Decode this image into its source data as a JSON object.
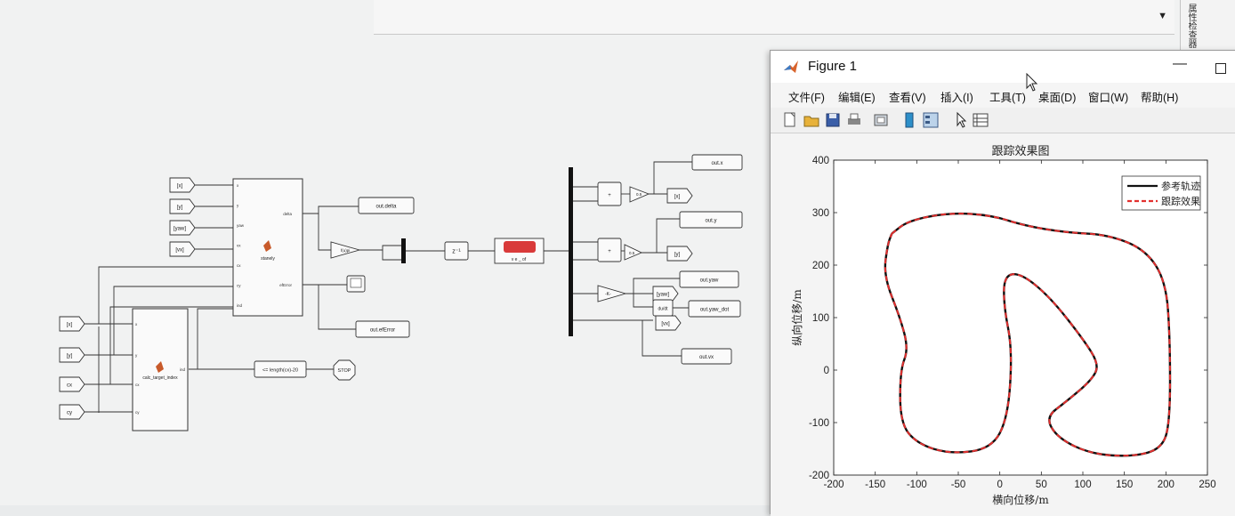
{
  "simulink": {
    "from_inputs_top": [
      "[x]",
      "[y]",
      "[yaw]",
      "[vx]"
    ],
    "from_inputs_bottom": [
      "[x]",
      "[y]",
      "cx",
      "cy"
    ],
    "stanley_block": {
      "name": "stanely",
      "ports_in": [
        "x",
        "y",
        "yaw",
        "vx",
        "cx",
        "cy",
        "ind"
      ],
      "ports_out": [
        "delta",
        "efError"
      ]
    },
    "calc_block": {
      "name": "calc_target_index",
      "ports_in": [
        "x",
        "y",
        "cx",
        "cy"
      ],
      "ports_out": [
        "ind"
      ]
    },
    "saturation_label": "f(u)pi",
    "delay_label": "z⁻¹",
    "vehicle_label": "v e _ of",
    "compare_label": "<= length(cx)-20",
    "stop_label": "STOP",
    "gain_labels": [
      "0.5",
      "0.5",
      "-K-"
    ],
    "goto_tags": [
      "[x]",
      "[y]",
      "[yaw]",
      "[vx]"
    ],
    "integrator_labels": [
      "du/dt"
    ],
    "workspace_outputs": [
      "out.delta",
      "out.efError",
      "out.x",
      "out.y",
      "out.yaw",
      "out.yaw_dot",
      "out.vx"
    ]
  },
  "side_panel": {
    "label": "属性检查器"
  },
  "figure": {
    "title": "Figure 1",
    "menus": [
      "文件(F)",
      "编辑(E)",
      "查看(V)",
      "插入(I)",
      "工具(T)",
      "桌面(D)",
      "窗口(W)",
      "帮助(H)"
    ],
    "toolbar_icons": [
      "new-file-icon",
      "open-folder-icon",
      "save-icon",
      "print-icon",
      "link-plot-icon",
      "colorbar-icon",
      "legend-icon",
      "pointer-icon",
      "data-cursor-icon"
    ],
    "colors": {
      "reference": "#111111",
      "tracked": "#e2302f"
    }
  },
  "chart_data": {
    "type": "line",
    "title": "跟踪效果图",
    "xlabel": "横向位移/m",
    "ylabel": "纵向位移/m",
    "xlim": [
      -200,
      250
    ],
    "ylim": [
      -200,
      400
    ],
    "xticks": [
      -200,
      -150,
      -100,
      -50,
      0,
      50,
      100,
      150,
      200,
      250
    ],
    "yticks": [
      -200,
      -100,
      0,
      100,
      200,
      300,
      400
    ],
    "grid": false,
    "legend_position": "top-right",
    "series": [
      {
        "name": "参考轨迹",
        "style": "solid",
        "x": [
          -130,
          -110,
          -60,
          -10,
          30,
          80,
          130,
          175,
          200,
          205,
          205,
          195,
          160,
          110,
          70,
          55,
          80,
          110,
          120,
          100,
          60,
          25,
          5,
          5,
          15,
          10,
          -10,
          -60,
          -100,
          -120,
          -120,
          -110,
          -120,
          -140,
          -135,
          -130
        ],
        "y": [
          260,
          285,
          300,
          295,
          275,
          262,
          258,
          230,
          170,
          60,
          -100,
          -150,
          -165,
          -160,
          -130,
          -90,
          -60,
          -20,
          10,
          60,
          140,
          185,
          180,
          120,
          40,
          -90,
          -150,
          -160,
          -140,
          -100,
          0,
          40,
          100,
          180,
          240,
          260
        ]
      },
      {
        "name": "跟踪效果",
        "style": "dashed",
        "x": [
          -130,
          -110,
          -60,
          -10,
          30,
          80,
          130,
          175,
          200,
          205,
          205,
          195,
          160,
          110,
          70,
          55,
          80,
          110,
          120,
          100,
          60,
          25,
          5,
          5,
          15,
          10,
          -10,
          -60,
          -100,
          -120,
          -120,
          -110,
          -120,
          -140,
          -135,
          -130
        ],
        "y": [
          260,
          285,
          300,
          295,
          275,
          262,
          258,
          230,
          170,
          60,
          -100,
          -150,
          -165,
          -160,
          -130,
          -90,
          -60,
          -20,
          10,
          60,
          140,
          185,
          180,
          120,
          40,
          -90,
          -150,
          -160,
          -140,
          -100,
          0,
          40,
          100,
          180,
          240,
          260
        ]
      }
    ]
  }
}
